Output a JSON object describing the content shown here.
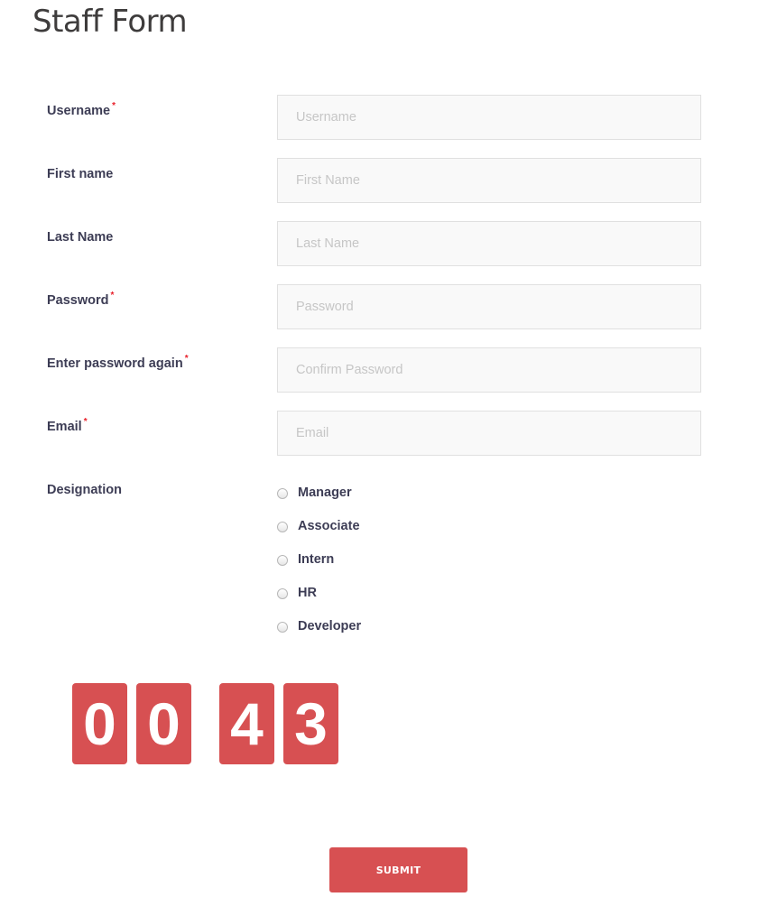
{
  "page": {
    "title": "Staff Form"
  },
  "form": {
    "fields": [
      {
        "label": "Username",
        "required": "*",
        "placeholder": "Username",
        "value": ""
      },
      {
        "label": "First name",
        "required": "",
        "placeholder": "First Name",
        "value": ""
      },
      {
        "label": "Last Name",
        "required": "",
        "placeholder": "Last Name",
        "value": ""
      },
      {
        "label": "Password",
        "required": "*",
        "placeholder": "Password",
        "value": ""
      },
      {
        "label": "Enter password again",
        "required": "*",
        "placeholder": "Confirm Password",
        "value": ""
      },
      {
        "label": "Email",
        "required": "*",
        "placeholder": "Email",
        "value": ""
      }
    ],
    "designation": {
      "label": "Designation",
      "options": [
        "Manager",
        "Associate",
        "Intern",
        "HR",
        "Developer"
      ],
      "selected": null
    }
  },
  "timer": {
    "digits": [
      "0",
      "0",
      "4",
      "3"
    ],
    "minutes": "00",
    "seconds": "43"
  },
  "submit": {
    "label": "SUBMIT"
  },
  "colors": {
    "accent": "#d75052",
    "required": "#e8202a",
    "label": "#3d3d55"
  }
}
